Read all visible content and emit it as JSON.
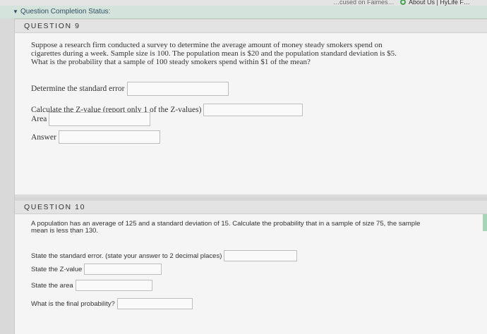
{
  "browser": {
    "bookmark_left": "…cused on Faimes…",
    "bookmark_right": "About Us | HyLife F…"
  },
  "status": {
    "label": "Question Completion Status:"
  },
  "q9": {
    "header": "QUESTION 9",
    "text_lines": [
      "Suppose a research firm conducted a survey to determine the average amount of money steady smokers spend on",
      "cigarettes during a week. Sample size is 100. The population mean is $20 and the population standard deviation is $5.",
      "What is the probability that a sample of 100 steady smokers spend within $1 of the mean?"
    ],
    "fields": {
      "std_error": {
        "label": "Determine the standard error",
        "value": ""
      },
      "z_value": {
        "label": "Calculate the Z-value (report only 1 of the Z-values)",
        "value": ""
      },
      "area": {
        "label": "Area",
        "value": ""
      },
      "answer": {
        "label": "Answer",
        "value": ""
      }
    }
  },
  "q10": {
    "header": "QUESTION 10",
    "text_lines": [
      "A population has an average of 125 and a standard deviation of 15. Calculate the probability that in a sample of size 75, the sample",
      "mean is less than 130."
    ],
    "fields": {
      "std_error": {
        "label": "State the standard error. (state your answer to 2 decimal places)",
        "value": ""
      },
      "z_value": {
        "label": "State the Z-value",
        "value": ""
      },
      "area": {
        "label": "State the area",
        "value": ""
      },
      "final_prob": {
        "label": "What is the final probability?",
        "value": ""
      }
    }
  },
  "colors": {
    "status_bar": "#d4e4dc",
    "accent_green": "#3ea34a",
    "page_bg": "#f5f5f5"
  }
}
